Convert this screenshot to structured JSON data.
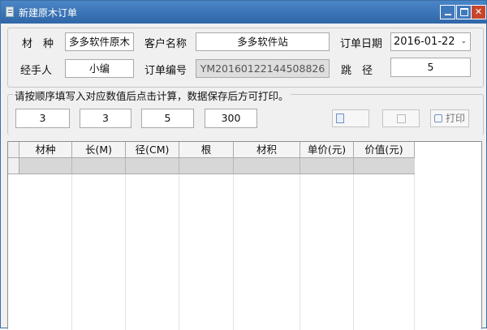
{
  "window": {
    "title": "新建原木订单"
  },
  "form": {
    "material_label": "材　种",
    "material_value": "多多软件原木",
    "customer_label": "客户名称",
    "customer_value": "多多软件站",
    "date_label": "订单日期",
    "date_value": "2016-01-22",
    "handler_label": "经手人",
    "handler_value": "小编",
    "order_no_label": "订单编号",
    "order_no_value": "YM20160122144508826",
    "jump_label": "跳　径",
    "jump_value": "5"
  },
  "calc": {
    "instruction": "请按顺序填写入对应数值后点击计算，数据保存后方可打印。",
    "inputs": [
      "3",
      "3",
      "5",
      "300"
    ],
    "buttons": {
      "print_label": "打印"
    }
  },
  "grid": {
    "columns": [
      "材种",
      "长(M)",
      "径(CM)",
      "根",
      "材积",
      "单价(元)",
      "价值(元)"
    ]
  }
}
